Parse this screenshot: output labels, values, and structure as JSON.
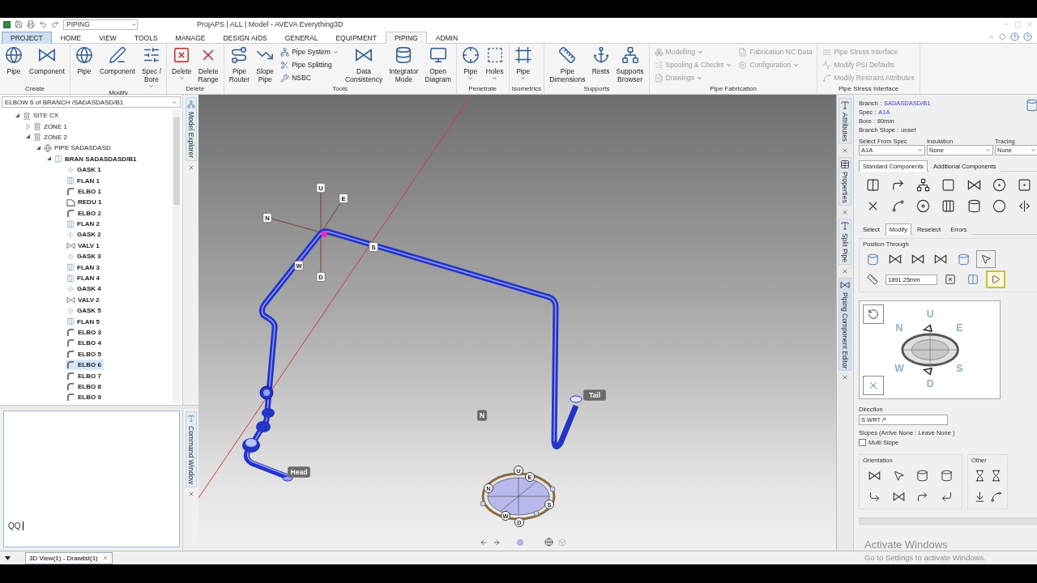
{
  "title_bar": {
    "combo": "PIPING",
    "title": "ProjAPS | ALL | Model - AVEVA Everything3D"
  },
  "tabs": [
    {
      "label": "PROJECT",
      "kind": "app",
      "selected": false
    },
    {
      "label": "HOME",
      "kind": "tab",
      "selected": false
    },
    {
      "label": "VIEW",
      "kind": "tab",
      "selected": false
    },
    {
      "label": "TOOLS",
      "kind": "tab",
      "selected": false
    },
    {
      "label": "MANAGE",
      "kind": "tab",
      "selected": false
    },
    {
      "label": "DESIGN AIDS",
      "kind": "tab",
      "selected": false
    },
    {
      "label": "GENERAL",
      "kind": "tab",
      "selected": false
    },
    {
      "label": "EQUIPMENT",
      "kind": "tab",
      "selected": false
    },
    {
      "label": "PIPING",
      "kind": "tab",
      "selected": true
    },
    {
      "label": "ADMIN",
      "kind": "tab",
      "selected": false
    }
  ],
  "ribbon": [
    {
      "label": "Create",
      "items": [
        {
          "kind": "large",
          "lines": [
            "Pipe"
          ],
          "dropdown": false,
          "disabled": false
        },
        {
          "kind": "large",
          "lines": [
            "Component"
          ],
          "dropdown": false,
          "disabled": false
        }
      ]
    },
    {
      "label": "Modify",
      "items": [
        {
          "kind": "large",
          "lines": [
            "Pipe"
          ],
          "dropdown": false,
          "disabled": false
        },
        {
          "kind": "large",
          "lines": [
            "Component"
          ],
          "dropdown": false,
          "disabled": false
        },
        {
          "kind": "large",
          "lines": [
            "Spec /",
            "Bore"
          ],
          "dropdown": true,
          "disabled": false
        }
      ]
    },
    {
      "label": "Delete",
      "items": [
        {
          "kind": "large",
          "lines": [
            "Delete"
          ],
          "dropdown": true,
          "disabled": false
        },
        {
          "kind": "large",
          "lines": [
            "Delete",
            "Range"
          ],
          "dropdown": false,
          "disabled": false
        }
      ]
    },
    {
      "label": "Tools",
      "items": [
        {
          "kind": "large",
          "lines": [
            "Pipe",
            "Router"
          ],
          "dropdown": false,
          "disabled": false
        },
        {
          "kind": "large",
          "lines": [
            "Slope",
            "Pipe"
          ],
          "dropdown": false,
          "disabled": false
        },
        {
          "kind": "small",
          "lines": [
            "Pipe System"
          ],
          "dropdown": true,
          "disabled": false
        },
        {
          "kind": "small",
          "lines": [
            "Pipe Splitting"
          ],
          "dropdown": false,
          "disabled": false
        },
        {
          "kind": "small",
          "lines": [
            "NSBC"
          ],
          "dropdown": false,
          "disabled": false
        },
        {
          "kind": "large",
          "lines": [
            "Data",
            "Consistency"
          ],
          "dropdown": false,
          "disabled": false
        },
        {
          "kind": "large",
          "lines": [
            "Integrator",
            "Mode"
          ],
          "dropdown": false,
          "disabled": false
        },
        {
          "kind": "large",
          "lines": [
            "Open",
            "Diagram"
          ],
          "dropdown": false,
          "disabled": false
        }
      ]
    },
    {
      "label": "Penetrate",
      "items": [
        {
          "kind": "large",
          "lines": [
            "Pipe"
          ],
          "dropdown": true,
          "disabled": false
        },
        {
          "kind": "large",
          "lines": [
            "Holes"
          ],
          "dropdown": true,
          "disabled": false
        }
      ]
    },
    {
      "label": "Isometrics",
      "items": [
        {
          "kind": "large",
          "lines": [
            "Pipe"
          ],
          "dropdown": true,
          "disabled": false
        }
      ]
    },
    {
      "label": "Supports",
      "items": [
        {
          "kind": "large",
          "lines": [
            "Pipe",
            "Dimensions"
          ],
          "dropdown": false,
          "disabled": false
        },
        {
          "kind": "large",
          "lines": [
            "Rests"
          ],
          "dropdown": false,
          "disabled": false
        },
        {
          "kind": "large",
          "lines": [
            "Supports",
            "Browser"
          ],
          "dropdown": false,
          "disabled": false
        }
      ]
    },
    {
      "label": "Pipe Fabrication",
      "items": [
        {
          "kind": "small",
          "lines": [
            "Modelling"
          ],
          "dropdown": true,
          "disabled": true
        },
        {
          "kind": "small",
          "lines": [
            "Spooling & Checks"
          ],
          "dropdown": true,
          "disabled": true
        },
        {
          "kind": "small",
          "lines": [
            "Drawings"
          ],
          "dropdown": true,
          "disabled": true
        },
        {
          "kind": "small",
          "lines": [
            "Fabrication NC Data"
          ],
          "dropdown": false,
          "disabled": true
        },
        {
          "kind": "small",
          "lines": [
            "Configuration"
          ],
          "dropdown": true,
          "disabled": true
        }
      ]
    },
    {
      "label": "Pipe Stress Interface",
      "items": [
        {
          "kind": "small",
          "lines": [
            "Pipe Stress Interface"
          ],
          "dropdown": false,
          "disabled": true
        },
        {
          "kind": "small",
          "lines": [
            "Modify PSI Defaults"
          ],
          "dropdown": false,
          "disabled": true
        },
        {
          "kind": "small",
          "lines": [
            "Modify Restraint Attributes"
          ],
          "dropdown": false,
          "disabled": true
        }
      ]
    }
  ],
  "model_explorer": {
    "tab": "Model Explorer",
    "header": "ELBOW 6 of BRANCH /SADASDASD/B1",
    "items": [
      {
        "label": "SITE CX",
        "kind": "site",
        "expanded": true,
        "selected": false,
        "children": [
          {
            "label": "ZONE 1",
            "kind": "zone",
            "expanded": false,
            "selected": false
          },
          {
            "label": "ZONE 2",
            "kind": "zone",
            "expanded": true,
            "selected": false,
            "children": [
              {
                "label": "PIPE SADASDASD",
                "kind": "pipe",
                "expanded": true,
                "selected": false,
                "children": [
                  {
                    "label": "BRAN SADASDASD/B1",
                    "kind": "branch",
                    "expanded": true,
                    "selected": false,
                    "children": [
                      {
                        "label": "GASK 1",
                        "kind": "gasket",
                        "selected": false
                      },
                      {
                        "label": "FLAN 1",
                        "kind": "flange",
                        "selected": false
                      },
                      {
                        "label": "ELBO 1",
                        "kind": "elbow",
                        "selected": false
                      },
                      {
                        "label": "REDU 1",
                        "kind": "reducer",
                        "selected": false
                      },
                      {
                        "label": "ELBO 2",
                        "kind": "elbow",
                        "selected": false
                      },
                      {
                        "label": "FLAN 2",
                        "kind": "flange",
                        "selected": false
                      },
                      {
                        "label": "GASK 2",
                        "kind": "gasket",
                        "selected": false
                      },
                      {
                        "label": "VALV 1",
                        "kind": "valve",
                        "selected": false
                      },
                      {
                        "label": "GASK 3",
                        "kind": "gasket",
                        "selected": false
                      },
                      {
                        "label": "FLAN 3",
                        "kind": "flange",
                        "selected": false
                      },
                      {
                        "label": "FLAN 4",
                        "kind": "flange",
                        "selected": false
                      },
                      {
                        "label": "GASK 4",
                        "kind": "gasket",
                        "selected": false
                      },
                      {
                        "label": "VALV 2",
                        "kind": "valve",
                        "selected": false
                      },
                      {
                        "label": "GASK 5",
                        "kind": "gasket",
                        "selected": false
                      },
                      {
                        "label": "FLAN 5",
                        "kind": "flange",
                        "selected": false
                      },
                      {
                        "label": "ELBO 3",
                        "kind": "elbow",
                        "selected": false
                      },
                      {
                        "label": "ELBO 4",
                        "kind": "elbow",
                        "selected": false
                      },
                      {
                        "label": "ELBO 5",
                        "kind": "elbow",
                        "selected": false
                      },
                      {
                        "label": "ELBO 6",
                        "kind": "elbow",
                        "selected": true
                      },
                      {
                        "label": "ELBO 7",
                        "kind": "elbow",
                        "selected": false
                      },
                      {
                        "label": "ELBO 8",
                        "kind": "elbow",
                        "selected": false
                      },
                      {
                        "label": "ELBO 9",
                        "kind": "elbow",
                        "selected": false
                      }
                    ]
                  }
                ]
              }
            ]
          }
        ]
      }
    ]
  },
  "command_window": {
    "tab": "Command Window",
    "value": "QQ"
  },
  "viewport": {
    "axis_labels": [
      "U",
      "E",
      "N",
      "S",
      "W",
      "D"
    ],
    "tags": [
      "Tail",
      "Head",
      "N"
    ],
    "compass_labels": [
      "U",
      "E",
      "N",
      "S",
      "W",
      "D"
    ]
  },
  "right_panel": {
    "side_tabs": [
      {
        "label": "Attributes",
        "selected": false
      },
      {
        "label": "Properties",
        "selected": false
      },
      {
        "label": "Split Pipe",
        "selected": false
      },
      {
        "label": "Piping Component Editor",
        "selected": true
      }
    ],
    "info": [
      {
        "label": "Branch :",
        "value": "SADASDASD/B1",
        "kind": "ref"
      },
      {
        "label": "Spec :",
        "value": "A1A",
        "kind": "ref"
      },
      {
        "label": "Bore :",
        "value": "80mm",
        "kind": "plain"
      },
      {
        "label": "Branch Slope :",
        "value": "unset",
        "kind": "plain"
      }
    ],
    "selects": [
      {
        "label": "Select From Spec",
        "value": "A1A"
      },
      {
        "label": "Insulation",
        "value": "None"
      },
      {
        "label": "Tracing",
        "value": "None"
      }
    ],
    "component_tabs": [
      {
        "label": "Standard Components",
        "selected": true
      },
      {
        "label": "Additional Components",
        "selected": false
      }
    ],
    "mode_tabs": [
      {
        "label": "Select",
        "selected": false
      },
      {
        "label": "Modify",
        "selected": true
      },
      {
        "label": "Reselect",
        "selected": false
      },
      {
        "label": "Errors",
        "selected": false
      }
    ],
    "position_through": {
      "title": "Position Through",
      "distance": "1891.25mm"
    },
    "gizmo_labels": [
      "U",
      "N",
      "E",
      "W",
      "S",
      "D"
    ],
    "direction": {
      "label": "Direction",
      "value": "S WRT /*"
    },
    "slopes": "Slopes (Arrive None : Leave None )",
    "multi_slope": {
      "label": "Multi Slope",
      "checked": false
    },
    "orientation": "Orientation",
    "other": "Other"
  },
  "document_tab": "3D View(1) - Drawlist(1)",
  "os_notice": {
    "title": "Activate Windows",
    "subtitle": "Go to Settings to activate Windows."
  }
}
